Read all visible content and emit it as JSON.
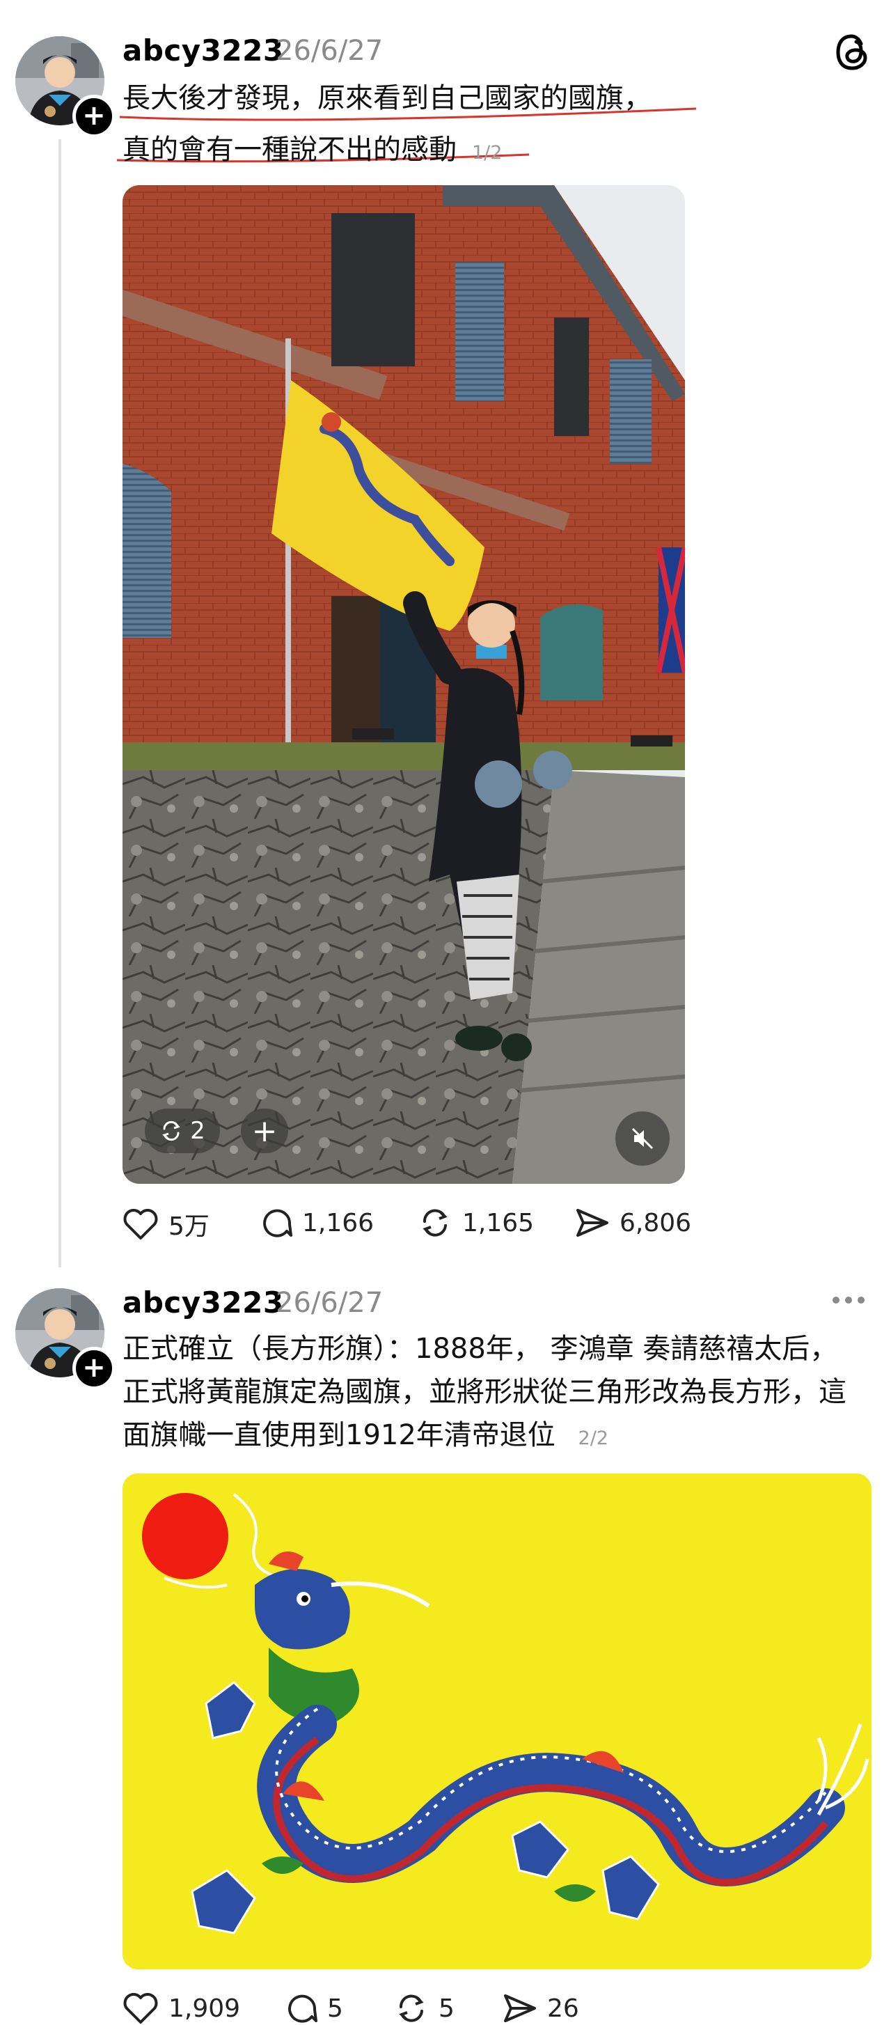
{
  "app": {
    "logo_icon": "threads-logo-icon"
  },
  "post1": {
    "username": "abcy3223",
    "date": "26/6/27",
    "text_line1": "長大後才發現，原來看到自己國家的國旗，",
    "text_line2": "真的會有一種說不出的感動",
    "pager": "1/2",
    "media": {
      "repost_count": "2",
      "mute_icon": "mute-icon"
    },
    "actions": {
      "likes": "5万",
      "comments": "1,166",
      "reposts": "1,165",
      "shares": "6,806"
    },
    "colors": {
      "underline": "#d9342b",
      "flag_yellow": "#f3d22a",
      "brick": "#b04a32"
    }
  },
  "post2": {
    "username": "abcy3223",
    "date": "26/6/27",
    "text": "正式確立（長方形旗）：1888年， 李鴻章 奏請慈禧太后，正式將黃龍旗定為國旗，並將形狀從三角形改為長方形，這面旗幟一直使用到1912年清帝退位",
    "pager": "2/2",
    "actions": {
      "likes": "1,909",
      "comments": "5",
      "reposts": "5",
      "shares": "26"
    },
    "colors": {
      "flag_yellow": "#f4ea1d",
      "sun_red": "#ef1c12",
      "dragon_blue": "#2c4fa4"
    }
  }
}
